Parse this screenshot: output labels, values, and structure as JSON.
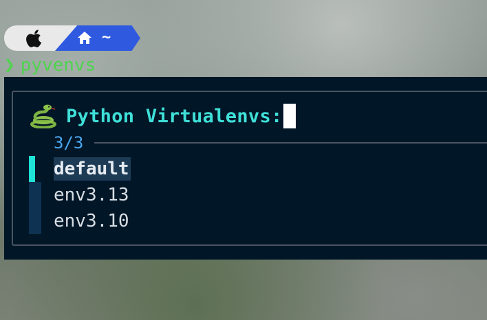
{
  "prompt": {
    "apple_icon": "apple-icon",
    "home_icon": "home-icon",
    "directory": "~",
    "arrow": "❯",
    "command": "pyvenvs",
    "colors": {
      "apple_segment": "#e9e9e9",
      "home_segment": "#2f5ae0",
      "command": "#4fd34f"
    }
  },
  "picker": {
    "icon": "snake-icon",
    "title": "Python Virtualenvs:",
    "counter": "3/3",
    "items": [
      {
        "label": "default",
        "selected": true
      },
      {
        "label": "env3.13",
        "selected": false
      },
      {
        "label": "env3.10",
        "selected": false
      }
    ],
    "colors": {
      "background": "#011627",
      "title": "#3fe0d8",
      "counter": "#4aa8f0",
      "selected_marker": "#1ee3d6"
    }
  }
}
